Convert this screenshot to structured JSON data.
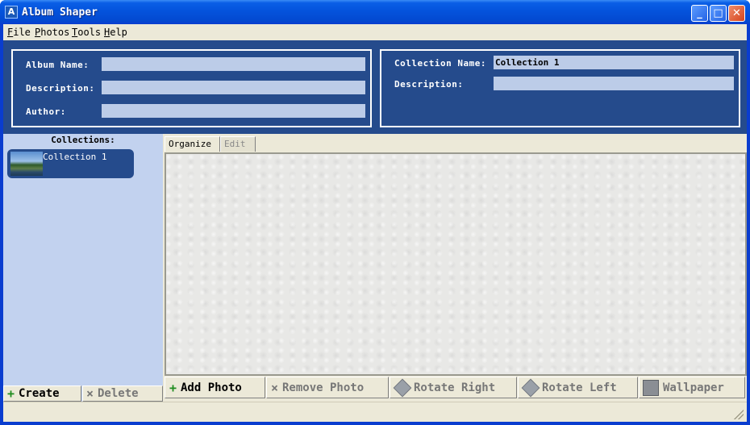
{
  "window": {
    "title": "Album Shaper",
    "icon": "album-shaper-app-icon"
  },
  "title_buttons": {
    "minimize": "_",
    "maximize": "□",
    "close": "✕"
  },
  "menu": [
    "File",
    "Photos",
    "Tools",
    "Help"
  ],
  "album": {
    "name_label": "Album Name:",
    "name_value": "",
    "description_label": "Description:",
    "description_value": "",
    "author_label": "Author:",
    "author_value": ""
  },
  "collection": {
    "name_label": "Collection Name:",
    "name_value": "Collection 1",
    "description_label": "Description:",
    "description_value": ""
  },
  "collections_panel": {
    "heading": "Collections:",
    "items": [
      {
        "name": "Collection 1",
        "thumbnail": "landscape-thumbnail"
      }
    ],
    "create_label": "Create",
    "delete_label": "Delete"
  },
  "tabs": [
    {
      "label": "Organize",
      "active": true
    },
    {
      "label": "Edit",
      "active": false
    }
  ],
  "toolbar": {
    "add_photo": "Add Photo",
    "remove_photo": "Remove Photo",
    "rotate_right": "Rotate Right",
    "rotate_left": "Rotate Left",
    "wallpaper": "Wallpaper"
  },
  "colors": {
    "panel_blue": "#254b8c",
    "sidebar": "#c2d2ef",
    "titlebar": "#0453dc",
    "add_green": "#1e8c1e"
  }
}
